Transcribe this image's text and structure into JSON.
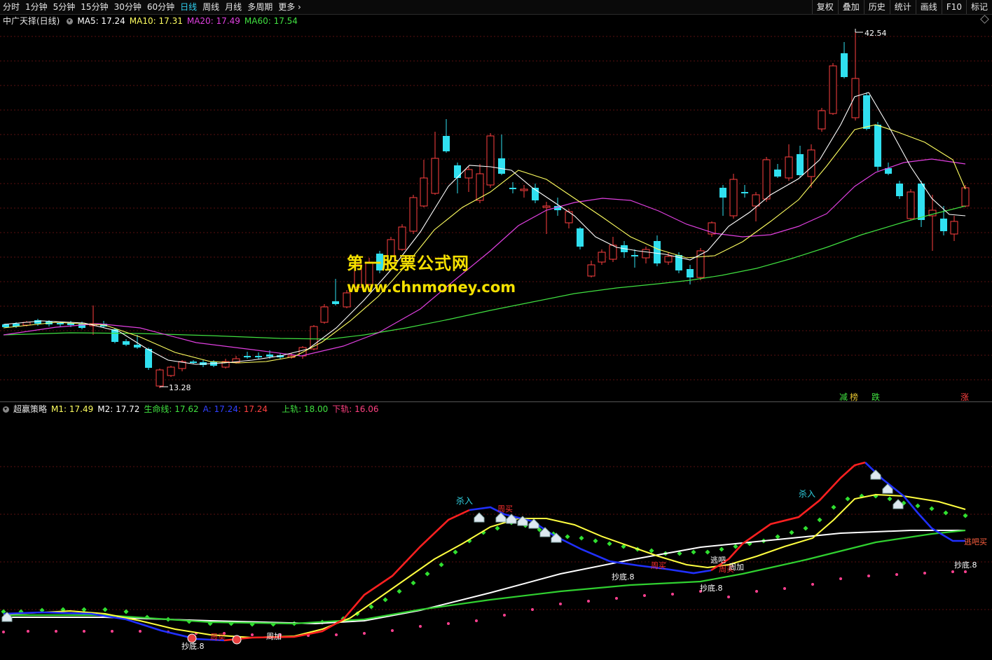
{
  "toolbar": {
    "periods": [
      "分时",
      "1分钟",
      "5分钟",
      "15分钟",
      "30分钟",
      "60分钟",
      "日线",
      "周线",
      "月线",
      "多周期",
      "更多"
    ],
    "active_period": "日线",
    "more_chevron": "›",
    "right_buttons": [
      "复权",
      "叠加",
      "历史",
      "统计",
      "画线",
      "F10",
      "标记"
    ]
  },
  "main_panel": {
    "title": "中广天择(日线)",
    "ma5_label": "MA5: 17.24",
    "ma10_label": "MA10: 17.31",
    "ma20_label": "MA20: 17.49",
    "ma60_label": "MA60: 17.54",
    "high_marker": "42.54",
    "low_marker": "13.28",
    "signal_jian": "减",
    "signal_bang": "榜",
    "signal_die": "跌",
    "signal_zhang": "涨",
    "colors": {
      "up": "#ff4040",
      "down": "#30e0f0",
      "ma5": "#ffffff",
      "ma10": "#ffff60",
      "ma20": "#e040e0",
      "ma60": "#40e040"
    }
  },
  "watermark": {
    "line1": "第一股票公式网",
    "line2": "www.chnmoney.com"
  },
  "indicator_panel": {
    "title": "超赢策略",
    "m1": "M1: 17.49",
    "m2": "M2: 17.72",
    "life_line": "生命线: 17.62",
    "a_value": "A: 17.24",
    "a_value2": ": 17.24",
    "upper": "上轨: 18.00",
    "lower": "下轨: 16.06",
    "annotations": {
      "kill_in_1": "杀入",
      "kill_in_2": "杀入",
      "zhou_mai_1": "周买",
      "zhou_mai_2": "周买",
      "zhou_mai_3": "周买",
      "zhou_mai_4": "周买",
      "zhou_jia_1": "周加",
      "zhou_jia_2": "周加",
      "tao_ba": "逃吧",
      "tao_ba_mai": "逃吧买",
      "bottom_1": "抄底.8",
      "bottom_2": "抄底.8",
      "bottom_3": "抄底.8",
      "bottom_4": "抄底.8",
      "bottom_5": "抄底.8"
    }
  }
}
